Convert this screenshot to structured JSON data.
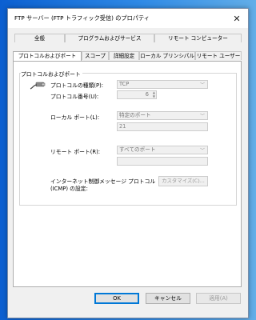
{
  "window": {
    "title": "FTP サーバー (FTP トラフィック受信) のプロパティ"
  },
  "tabs": {
    "row1": [
      "全般",
      "プログラムおよびサービス",
      "リモート コンピューター"
    ],
    "row2": [
      "プロトコルおよびポート",
      "スコープ",
      "詳細設定",
      "ローカル プリンシパル",
      "リモート ユーザー"
    ],
    "active": "プロトコルおよびポート"
  },
  "group": {
    "title": "プロトコルおよびポート",
    "protocol_type_label": "プロトコルの種類(P):",
    "protocol_type_value": "TCP",
    "protocol_number_label": "プロトコル番号(U):",
    "protocol_number_value": "6",
    "local_port_label": "ローカル ポート(L):",
    "local_port_value": "特定のポート",
    "local_port_text": "21",
    "remote_port_label": "リモート ポート(R):",
    "remote_port_value": "すべてのポート",
    "remote_port_text": "",
    "icmp_label_line1": "インターネット制御メッセージ プロトコル",
    "icmp_label_line2": "(ICMP) の設定:",
    "customize_button": "カスタマイズ(C)..."
  },
  "footer": {
    "ok": "OK",
    "cancel": "キャンセル",
    "apply": "適用(A)"
  },
  "icons": {
    "close": "close-icon",
    "network": "network-cable-icon"
  }
}
